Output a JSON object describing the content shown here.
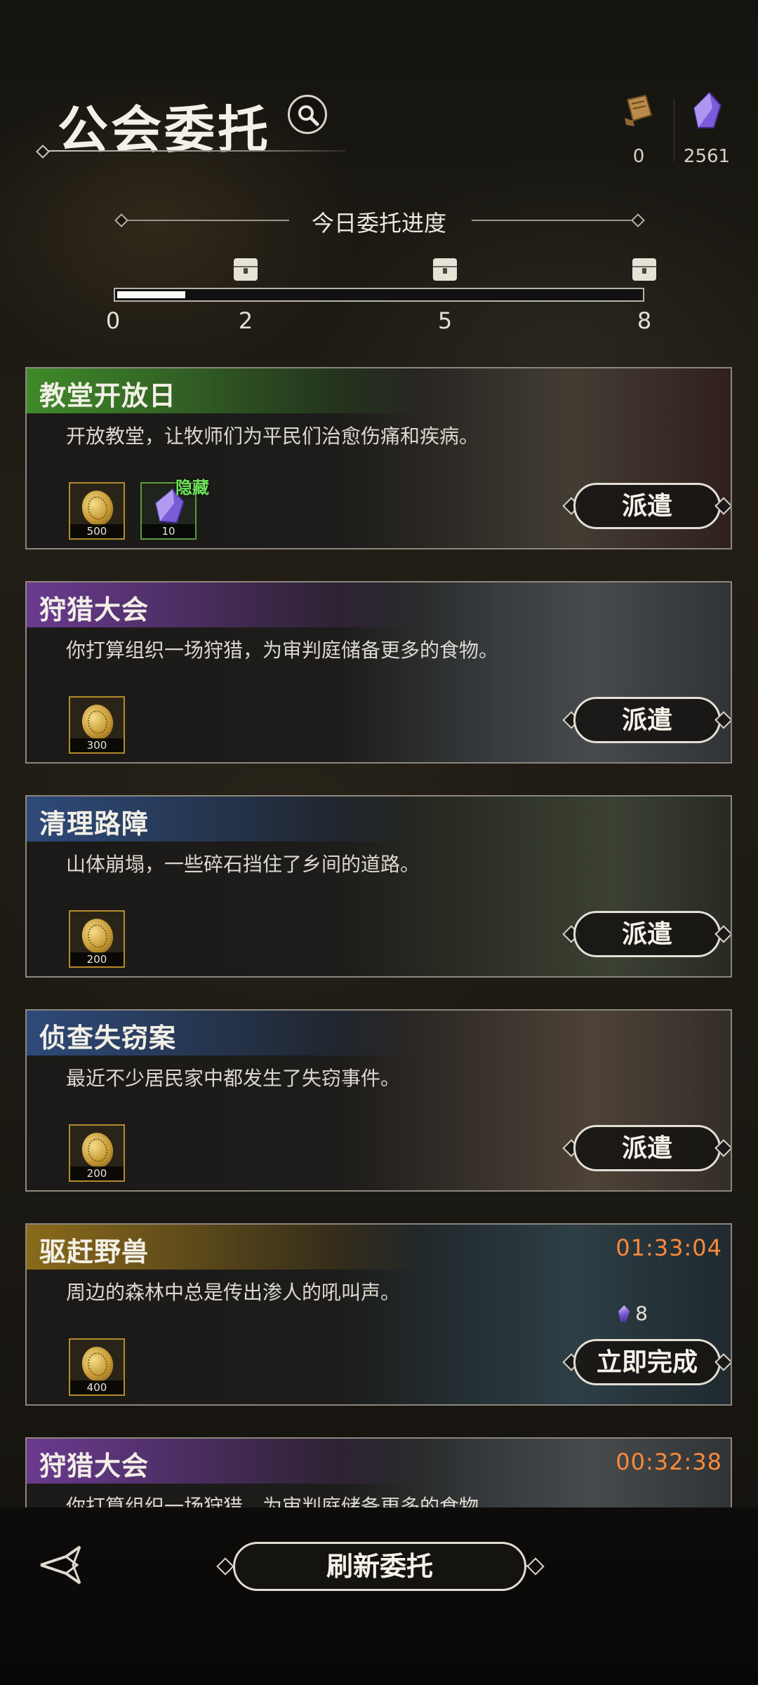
{
  "header": {
    "title": "公会委托"
  },
  "resources": [
    {
      "icon": "scroll-icon",
      "value": "0"
    },
    {
      "icon": "crystal-icon",
      "value": "2561"
    }
  ],
  "progress": {
    "label": "今日委托进度",
    "current_fraction": 0.13,
    "ticks": [
      "0",
      "2",
      "5",
      "8"
    ]
  },
  "cards": [
    {
      "title": "教堂开放日",
      "desc": "开放教堂，让牧师们为平民们治愈伤痛和疾病。",
      "accent": "#3f8a2a",
      "rewards": [
        {
          "type": "coin",
          "amount": "500"
        },
        {
          "type": "crystal",
          "amount": "10",
          "tag": "隐藏"
        }
      ],
      "action": "派遣"
    },
    {
      "title": "狩猎大会",
      "desc": "你打算组织一场狩猎，为审判庭储备更多的食物。",
      "accent": "#6a3a8f",
      "rewards": [
        {
          "type": "coin",
          "amount": "300"
        }
      ],
      "action": "派遣"
    },
    {
      "title": "清理路障",
      "desc": "山体崩塌，一些碎石挡住了乡间的道路。",
      "accent": "#2e4a7a",
      "rewards": [
        {
          "type": "coin",
          "amount": "200"
        }
      ],
      "action": "派遣"
    },
    {
      "title": "侦查失窃案",
      "desc": "最近不少居民家中都发生了失窃事件。",
      "accent": "#2e4a7a",
      "rewards": [
        {
          "type": "coin",
          "amount": "200"
        }
      ],
      "action": "派遣"
    },
    {
      "title": "驱赶野兽",
      "desc": "周边的森林中总是传出渗人的吼叫声。",
      "accent": "#8a6a1a",
      "timer": "01:33:04",
      "cost": "8",
      "rewards": [
        {
          "type": "coin",
          "amount": "400"
        }
      ],
      "action": "立即完成"
    },
    {
      "title": "狩猎大会",
      "desc": "你打算组织一场狩猎，为审判庭储备更多的食物。",
      "accent": "#6a3a8f",
      "timer": "00:32:38"
    }
  ],
  "footer": {
    "refresh_label": "刷新委托"
  }
}
